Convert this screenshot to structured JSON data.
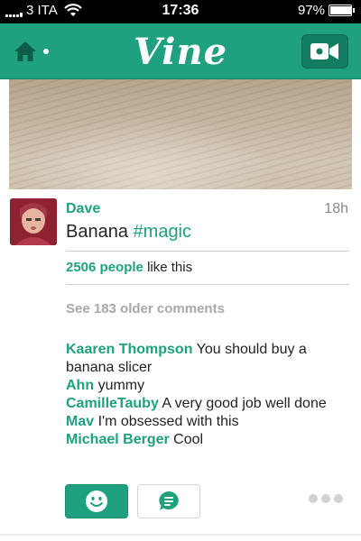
{
  "status_bar": {
    "carrier": "3 ITA",
    "time": "17:36",
    "battery_percent": "97%",
    "battery_level": 0.97
  },
  "nav": {
    "logo": "Vine",
    "home_icon": "home-icon",
    "camera_icon": "video-camera-icon"
  },
  "post": {
    "author": "Dave",
    "time_ago": "18h",
    "caption_text": "Banana",
    "caption_hashtag": "#magic",
    "likes_count": "2506 people",
    "likes_suffix": "like this",
    "see_older": "See 183 older comments"
  },
  "comments": [
    {
      "name": "Kaaren Thompson",
      "text": "You should buy a banana slicer"
    },
    {
      "name": "Ahn",
      "text": "yummy"
    },
    {
      "name": "CamilleTauby",
      "text": "A very good job well done"
    },
    {
      "name": "Mav",
      "text": "I'm obsessed with this"
    },
    {
      "name": "Michael Berger",
      "text": "Cool"
    }
  ],
  "actions": {
    "like_icon": "smiley-icon",
    "comment_icon": "comment-bubble-icon",
    "more_icon": "more-dots-icon"
  },
  "colors": {
    "accent": "#1fa17f",
    "nav_button": "#127c60",
    "muted_text": "#a8a8a8"
  }
}
